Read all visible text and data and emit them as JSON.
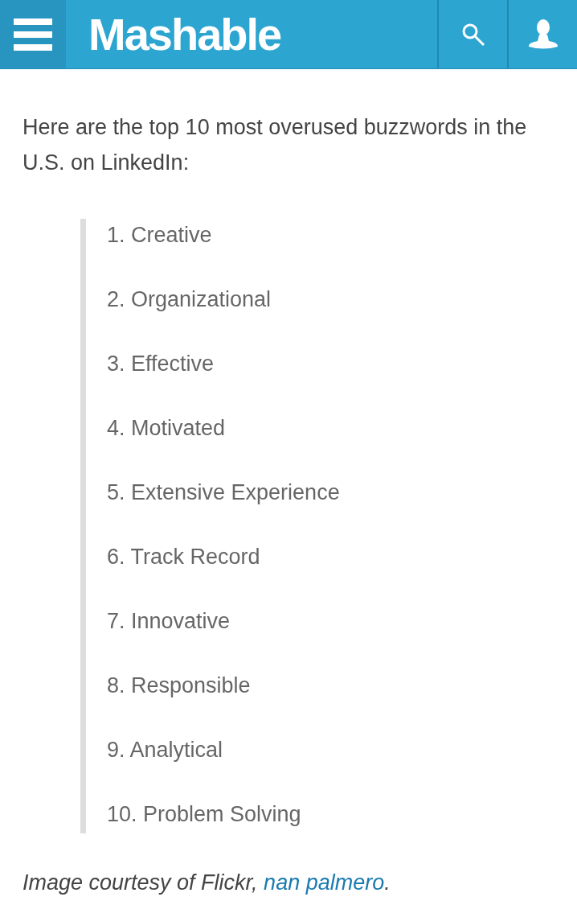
{
  "header": {
    "logo": "Mashable"
  },
  "intro": "Here are the top 10 most overused buzzwords in the U.S. on LinkedIn:",
  "buzzwords": [
    "1. Creative",
    "2. Organizational",
    "3. Effective",
    "4. Motivated",
    "5. Extensive Experience",
    "6. Track Record",
    "7. Innovative",
    "8. Responsible",
    "9. Analytical",
    "10. Problem Solving"
  ],
  "caption": {
    "text": "Image courtesy of Flickr, ",
    "link": "nan palmero",
    "end": "."
  }
}
